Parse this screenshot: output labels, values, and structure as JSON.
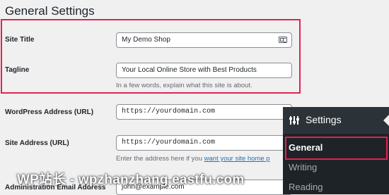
{
  "page": {
    "title": "General Settings"
  },
  "fields": {
    "site_title": {
      "label": "Site Title",
      "value": "My Demo Shop"
    },
    "tagline": {
      "label": "Tagline",
      "value": "Your Local Online Store with Best Products",
      "description": "In a few words, explain what this site is about."
    },
    "wordpress_address": {
      "label": "WordPress Address (URL)",
      "value": "https://yourdomain.com"
    },
    "site_address": {
      "label": "Site Address (URL)",
      "value": "https://yourdomain.com",
      "description_prefix": "Enter the address here if you ",
      "description_link": "want your site home p"
    },
    "admin_email": {
      "label": "Administration Email Address",
      "value": "john@example.com"
    }
  },
  "admin_menu": {
    "header_label": "Settings",
    "header_icon": "settings-sliders-icon",
    "items": [
      {
        "label": "General",
        "current": true
      },
      {
        "label": "Writing",
        "current": false
      },
      {
        "label": "Reading",
        "current": false
      }
    ]
  },
  "watermark": {
    "text": "WP站长 - wpzhanzhang.eastfu.com"
  },
  "colors": {
    "highlight": "#e0234f",
    "admin_menu_bg": "#1d2327",
    "link": "#2271b1"
  }
}
